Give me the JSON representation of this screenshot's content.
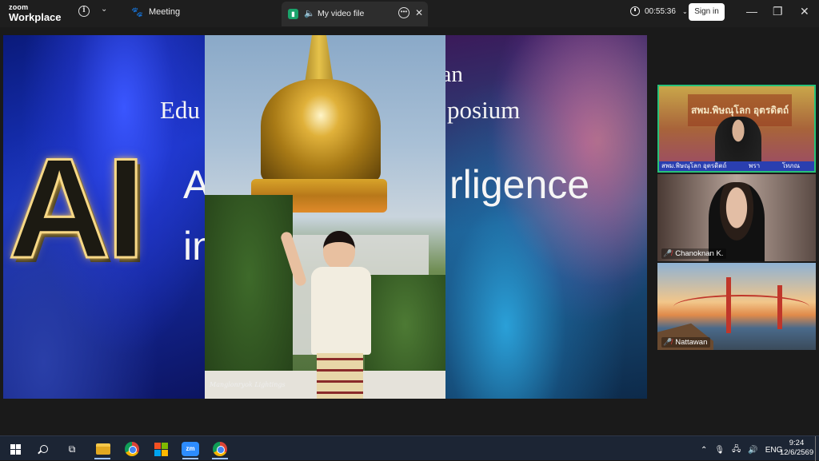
{
  "titlebar": {
    "logo_line1": "zoom",
    "logo_line2": "Workplace",
    "info_icon": "i",
    "chevron_icon": "⌄",
    "meeting_icon": "paw-icon",
    "meeting_label": "Meeting",
    "video_tab_badge": "▮",
    "video_tab_title": "My video file",
    "video_tab_more": "•••",
    "video_tab_close": "✕",
    "timer": "00:55:36",
    "timer_chevron": "⌄",
    "signin_label": "Sign in",
    "minimize": "—",
    "maximize": "❐",
    "close": "✕"
  },
  "slide": {
    "line1": "oan",
    "line2a": "Edu",
    "line2b": "posium",
    "line3a": "A",
    "line3b": "rligence",
    "line4a": "in",
    "ai_logo": "AI",
    "watermark": "Manglonryok Lightings"
  },
  "participants": [
    {
      "name": "",
      "banner": "สพม.พิษณุโลก อุตรดิตถ์",
      "strip_left": "สพม.พิษณุโลก อุตรดิตถ์",
      "strip_mid": "พรา",
      "strip_right": "โทภณ",
      "active": true
    },
    {
      "name": "Chanoknan K.",
      "muted": true
    },
    {
      "name": "Nattawan",
      "muted": true
    }
  ],
  "taskbar": {
    "tray_chevron": "⌃",
    "tray_lang": "ENG",
    "time": "9:24",
    "date": "12/6/2569",
    "zoom_label": "zm"
  },
  "colors": {
    "active_speaker_border": "#27c27a",
    "zoom_blue": "#2d8cff",
    "muted_red": "#e63b3b"
  }
}
